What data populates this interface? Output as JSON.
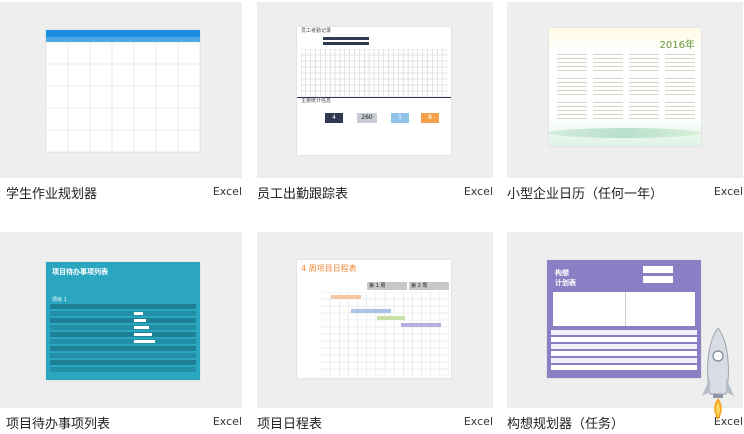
{
  "cards": [
    {
      "title": "学生作业规划器",
      "app": "Excel"
    },
    {
      "title": "员工出勤跟踪表",
      "app": "Excel"
    },
    {
      "title": "小型企业日历（任何一年）",
      "app": "Excel"
    },
    {
      "title": "项目待办事项列表",
      "app": "Excel"
    },
    {
      "title": "项目日程表",
      "app": "Excel"
    },
    {
      "title": "构想规划器（任务）",
      "app": "Excel"
    }
  ],
  "thumb_texts": {
    "attendance_heading": "员工考勤记录",
    "attendance_stats_heading": "主要统计信息",
    "attendance_values": [
      "4",
      "260",
      "1",
      "8"
    ],
    "calendar_year": "2016年",
    "todo_heading": "项目待办事项列表",
    "todo_sub": "项目 1",
    "schedule_heading": "4 周项目日程表",
    "schedule_week1": "第 1 周",
    "schedule_week2": "第 2 周",
    "ideas_heading_1": "构想",
    "ideas_heading_2": "计划表"
  },
  "colors": {
    "student_blue": "#1b8ee0",
    "attendance_navy": "#2e3a4f",
    "todo_teal": "#2aa6c0",
    "schedule_orange": "#f0883a",
    "ideas_purple": "#8a7fc4"
  }
}
